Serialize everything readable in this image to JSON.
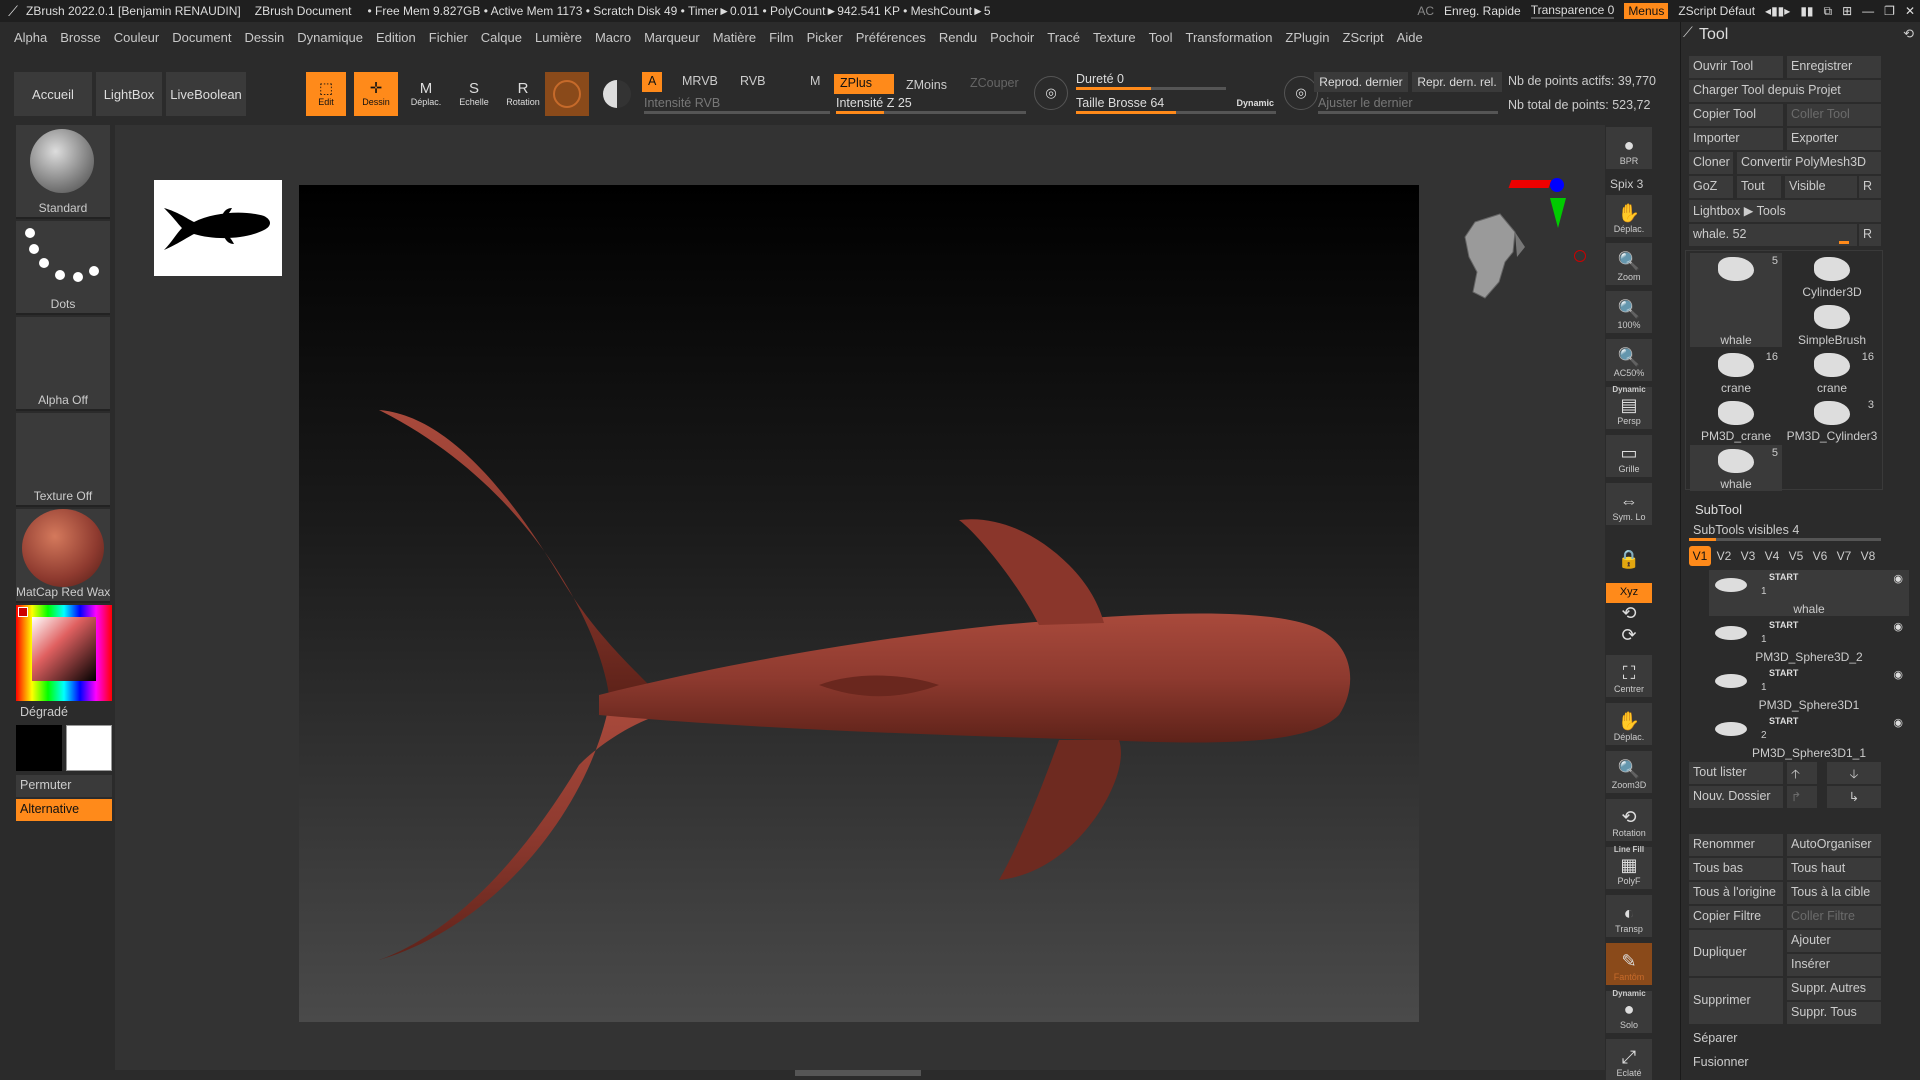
{
  "titlebar": {
    "app": "ZBrush 2022.0.1 [Benjamin RENAUDIN]",
    "document": "ZBrush Document",
    "stats": "• Free Mem 9.827GB • Active Mem 1173 • Scratch Disk 49 • Timer►0.011 • PolyCount►942.541 KP • MeshCount►5",
    "ac": "AC",
    "quicksave": "Enreg. Rapide",
    "transparency": "Transparence 0",
    "menus": "Menus",
    "script": "ZScript Défaut"
  },
  "menubar": [
    "Alpha",
    "Brosse",
    "Couleur",
    "Document",
    "Dessin",
    "Dynamique",
    "Edition",
    "Fichier",
    "Calque",
    "Lumière",
    "Macro",
    "Marqueur",
    "Matière",
    "Film",
    "Picker",
    "Préférences",
    "Rendu",
    "Pochoir",
    "Tracé",
    "Texture",
    "Tool",
    "Transformation",
    "ZPlugin",
    "ZScript",
    "Aide"
  ],
  "toolbar": {
    "home": "Accueil",
    "lightbox": "LightBox",
    "liveboolean": "LiveBoolean",
    "edit": "Edit",
    "draw": "Dessin",
    "move": "Déplac.",
    "scale": "Echelle",
    "rotate": "Rotation",
    "a": "A",
    "mrgb": "MRVB",
    "rgb": "RVB",
    "m": "M",
    "rgb_intensity": "Intensité RVB",
    "zadd": "ZPlus",
    "zsub": "ZMoins",
    "zcut": "ZCouper",
    "z_intensity": "Intensité Z 25",
    "z_intensity_value": 25,
    "focal_shift": "Dureté 0",
    "draw_size": "Taille Brosse 64",
    "dynamic": "Dynamic",
    "draw_size_value": 64,
    "replay_last": "Reprod. dernier",
    "replay_last_rel": "Repr. dern. rel.",
    "adjust_last": "Ajuster le dernier",
    "active_points": "Nb de points actifs: 39,770",
    "total_points": "Nb total de points: 523,72"
  },
  "leftshelf": {
    "brush": "Standard",
    "stroke": "Dots",
    "alpha": "Alpha Off",
    "texture": "Texture Off",
    "material": "MatCap Red Wax",
    "gradient": "Dégradé",
    "switch": "Permuter",
    "alternate": "Alternative"
  },
  "rightshelf": {
    "bpr": "BPR",
    "spix": "Spix 3",
    "move": "Déplac.",
    "zoom": "Zoom",
    "actual": "100%",
    "aahalf": "AC50%",
    "dynamic": "Dynamic",
    "persp": "Persp",
    "floor": "Grille",
    "local": "Sym. Lo",
    "xyz": "Xyz",
    "frame": "Centrer",
    "move2": "Déplac.",
    "zoom3d": "Zoom3D",
    "rotate": "Rotation",
    "linefill": "Line Fill",
    "polyf": "PolyF",
    "transp": "Transp",
    "ghost": "Fantôm",
    "dynamic2": "Dynamic",
    "solo": "Solo",
    "xpose": "Eclaté"
  },
  "palette": {
    "title": "Tool",
    "load": "Ouvrir Tool",
    "save": "Enregistrer",
    "load_project": "Charger Tool depuis Projet",
    "copy": "Copier Tool",
    "paste": "Coller Tool",
    "import": "Importer",
    "export": "Exporter",
    "clone": "Cloner",
    "make_polymesh": "Convertir PolyMesh3D",
    "goz": "GoZ",
    "all": "Tout",
    "visible": "Visible",
    "r": "R",
    "lightbox_tools": "Lightbox ▶ Tools",
    "current_tool": "whale. 52",
    "tools": [
      {
        "name": "whale",
        "count": "5"
      },
      {
        "name": "Cylinder3D",
        "count": ""
      },
      {
        "name": "SimpleBrush",
        "count": ""
      },
      {
        "name": "crane",
        "count": "16"
      },
      {
        "name": "crane",
        "count": "16"
      },
      {
        "name": "PM3D_crane",
        "count": ""
      },
      {
        "name": "PM3D_Cylinder3",
        "count": "3"
      },
      {
        "name": "whale",
        "count": "5"
      }
    ],
    "subtool": "SubTool",
    "visible_count": "SubTools visibles 4",
    "visible_count_value": 4,
    "vtabs": [
      "V1",
      "V2",
      "V3",
      "V4",
      "V5",
      "V6",
      "V7",
      "V8"
    ],
    "subtools": [
      {
        "name": "whale",
        "start": "START",
        "level": "1"
      },
      {
        "name": "PM3D_Sphere3D_2",
        "start": "START",
        "level": "1"
      },
      {
        "name": "PM3D_Sphere3D1",
        "start": "START",
        "level": "1"
      },
      {
        "name": "PM3D_Sphere3D1_1",
        "start": "START",
        "level": "2"
      }
    ],
    "list_all": "Tout lister",
    "new_folder": "Nouv. Dossier",
    "rename": "Renommer",
    "autoreorder": "AutoOrganiser",
    "all_low": "Tous bas",
    "all_high": "Tous haut",
    "all_origin": "Tous à l'origine",
    "all_target": "Tous à la cible",
    "copy_filter": "Copier Filtre",
    "paste_filter": "Coller Filtre",
    "duplicate": "Dupliquer",
    "append": "Ajouter",
    "insert": "Insérer",
    "delete": "Supprimer",
    "del_other": "Suppr. Autres",
    "del_all": "Suppr. Tous",
    "split": "Séparer",
    "merge": "Fusionner"
  },
  "colors": {
    "accent": "#ff8a1a",
    "whale": "#8e3a2f",
    "panel": "#3a3a3a",
    "background": "#2b2b2b"
  }
}
